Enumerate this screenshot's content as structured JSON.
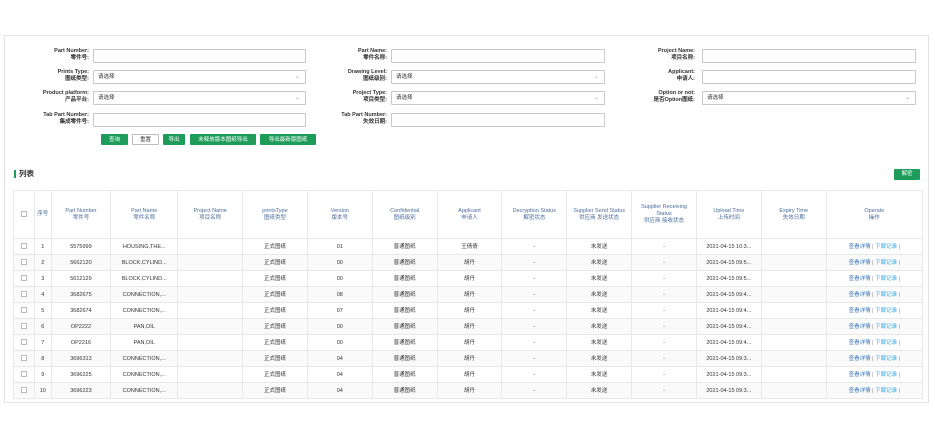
{
  "filters": {
    "row1": [
      {
        "label_en": "Part Number:",
        "label_cn": "零件号:",
        "type": "input",
        "value": ""
      },
      {
        "label_en": "Part Name:",
        "label_cn": "零件名称:",
        "type": "input",
        "value": ""
      },
      {
        "label_en": "Project Name:",
        "label_cn": "项目名称:",
        "type": "input",
        "value": ""
      }
    ],
    "row2": [
      {
        "label_en": "Prints Type:",
        "label_cn": "图纸类型:",
        "type": "select",
        "value": "请选择"
      },
      {
        "label_en": "Drawing Level:",
        "label_cn": "图纸级别:",
        "type": "select",
        "value": "请选择"
      },
      {
        "label_en": "Applicant:",
        "label_cn": "申请人:",
        "type": "input",
        "value": ""
      }
    ],
    "row3": [
      {
        "label_en": "Product platform:",
        "label_cn": "产品平台:",
        "type": "select",
        "value": "请选择"
      },
      {
        "label_en": "Project Type:",
        "label_cn": "项目类型:",
        "type": "select",
        "value": "请选择"
      },
      {
        "label_en": "Option or not:",
        "label_cn": "是否Option图纸:",
        "type": "select",
        "value": "请选择"
      }
    ],
    "row4": [
      {
        "label_en": "Tab Part Number:",
        "label_cn": "集成零件号:",
        "type": "input",
        "value": ""
      },
      {
        "label_en": "Tab Part Number:",
        "label_cn": "失效日期:",
        "type": "input",
        "value": ""
      }
    ]
  },
  "buttons": {
    "query": "查询",
    "reset": "重置",
    "export": "导出",
    "export_unissued": "未释放版本图纸导出",
    "export_latest": "导出最新版图纸"
  },
  "list": {
    "title": "列表",
    "decrypt_label": "解密"
  },
  "table": {
    "headers": [
      {
        "en": "",
        "cn": ""
      },
      {
        "en": "序号",
        "cn": ""
      },
      {
        "en": "Part Number",
        "cn": "零件号"
      },
      {
        "en": "Part Name",
        "cn": "零件名称"
      },
      {
        "en": "Project Name",
        "cn": "项目名称"
      },
      {
        "en": "printsType",
        "cn": "图纸类型"
      },
      {
        "en": "Version",
        "cn": "版本号"
      },
      {
        "en": "Confidential",
        "cn": "图纸级别"
      },
      {
        "en": "Applicant",
        "cn": "申请人"
      },
      {
        "en": "Decryption Status",
        "cn": "解密状态"
      },
      {
        "en": "Supplier Send Status",
        "cn": "供应商 发送状态"
      },
      {
        "en": "Supplier Receiving Status",
        "cn": "供应商 接收状态"
      },
      {
        "en": "Upload Time",
        "cn": "上传时间"
      },
      {
        "en": "Expiry Time",
        "cn": "失效日期"
      },
      {
        "en": "Operate",
        "cn": "操作"
      }
    ],
    "op_view": "查看详情",
    "op_sep": "|",
    "op_download": "下载记录",
    "rows": [
      {
        "idx": "1",
        "part_number": "5575999",
        "part_name": "HOUSING,THE...",
        "project_name": "",
        "prints_type": "正式图纸",
        "version": "01",
        "confidential": "普通图纸",
        "applicant": "王倩倩",
        "decryption": "-",
        "send": "未发送",
        "receive": "-",
        "upload": "2021-04-15 10:3...",
        "expiry": ""
      },
      {
        "idx": "2",
        "part_number": "5662120",
        "part_name": "BLOCK,CYLIND...",
        "project_name": "",
        "prints_type": "正式图纸",
        "version": "00",
        "confidential": "普通图纸",
        "applicant": "胡丹",
        "decryption": "-",
        "send": "未发送",
        "receive": "-",
        "upload": "2021-04-15 09:5...",
        "expiry": ""
      },
      {
        "idx": "3",
        "part_number": "5612129",
        "part_name": "BLOCK,CYLIND...",
        "project_name": "",
        "prints_type": "正式图纸",
        "version": "00",
        "confidential": "普通图纸",
        "applicant": "胡丹",
        "decryption": "-",
        "send": "未发送",
        "receive": "-",
        "upload": "2021-04-15 09:5...",
        "expiry": ""
      },
      {
        "idx": "4",
        "part_number": "3682675",
        "part_name": "CONNECTION,...",
        "project_name": "",
        "prints_type": "正式图纸",
        "version": "08",
        "confidential": "普通图纸",
        "applicant": "胡丹",
        "decryption": "-",
        "send": "未发送",
        "receive": "-",
        "upload": "2021-04-15 09:4...",
        "expiry": ""
      },
      {
        "idx": "5",
        "part_number": "3682674",
        "part_name": "CONNECTION,...",
        "project_name": "",
        "prints_type": "正式图纸",
        "version": "07",
        "confidential": "普通图纸",
        "applicant": "胡丹",
        "decryption": "-",
        "send": "未发送",
        "receive": "-",
        "upload": "2021-04-15 09:4...",
        "expiry": ""
      },
      {
        "idx": "6",
        "part_number": "OP2222",
        "part_name": "PAN,OIL",
        "project_name": "",
        "prints_type": "正式图纸",
        "version": "00",
        "confidential": "普通图纸",
        "applicant": "胡丹",
        "decryption": "-",
        "send": "未发送",
        "receive": "-",
        "upload": "2021-04-15 09:4...",
        "expiry": ""
      },
      {
        "idx": "7",
        "part_number": "OP2216",
        "part_name": "PAN,OIL",
        "project_name": "",
        "prints_type": "正式图纸",
        "version": "00",
        "confidential": "普通图纸",
        "applicant": "胡丹",
        "decryption": "-",
        "send": "未发送",
        "receive": "-",
        "upload": "2021-04-15 09:4...",
        "expiry": ""
      },
      {
        "idx": "8",
        "part_number": "3696313",
        "part_name": "CONNECTION,...",
        "project_name": "",
        "prints_type": "正式图纸",
        "version": "04",
        "confidential": "普通图纸",
        "applicant": "胡丹",
        "decryption": "-",
        "send": "未发送",
        "receive": "-",
        "upload": "2021-04-15 09:3...",
        "expiry": ""
      },
      {
        "idx": "9",
        "part_number": "3696225",
        "part_name": "CONNECTION,...",
        "project_name": "",
        "prints_type": "正式图纸",
        "version": "04",
        "confidential": "普通图纸",
        "applicant": "胡丹",
        "decryption": "-",
        "send": "未发送",
        "receive": "-",
        "upload": "2021-04-15 09:3...",
        "expiry": ""
      },
      {
        "idx": "10",
        "part_number": "3696223",
        "part_name": "CONNECTION,...",
        "project_name": "",
        "prints_type": "正式图纸",
        "version": "04",
        "confidential": "普通图纸",
        "applicant": "胡丹",
        "decryption": "-",
        "send": "未发送",
        "receive": "-",
        "upload": "2021-04-15 09:3...",
        "expiry": ""
      }
    ]
  },
  "icons": {
    "select_chevron": "chevron-down-icon",
    "checkbox": "checkbox-icon"
  },
  "colors": {
    "accent_green": "#1e9c5a",
    "header_text": "#4a6d9c",
    "link_view": "#3b74b8",
    "link_download": "#3aa6d8"
  }
}
